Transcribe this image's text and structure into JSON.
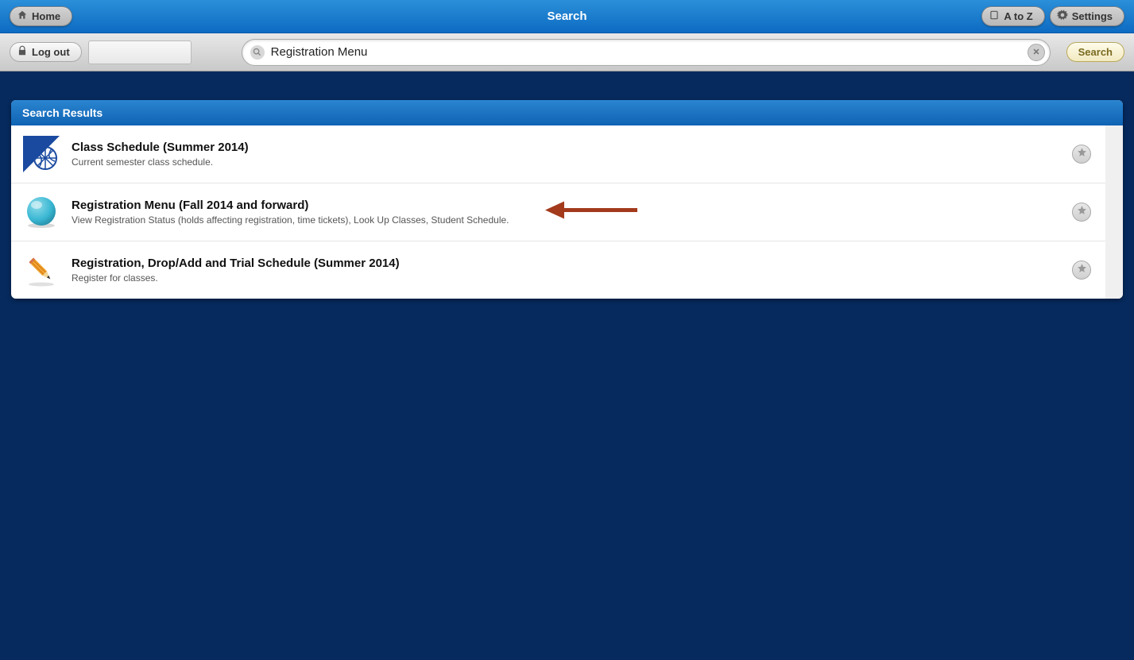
{
  "header": {
    "home_label": "Home",
    "title": "Search",
    "atoz_label": "A to Z",
    "settings_label": "Settings"
  },
  "secondary": {
    "logout_label": "Log out"
  },
  "search": {
    "value": "Registration Menu",
    "button_label": "Search"
  },
  "panel": {
    "header": "Search Results",
    "results": [
      {
        "title": "Class Schedule (Summer 2014)",
        "desc": "Current semester class schedule."
      },
      {
        "title": "Registration Menu (Fall 2014 and forward)",
        "desc": "View Registration Status (holds affecting registration, time tickets), Look Up Classes, Student Schedule."
      },
      {
        "title": "Registration, Drop/Add and Trial Schedule (Summer 2014)",
        "desc": "Register for classes."
      }
    ]
  }
}
